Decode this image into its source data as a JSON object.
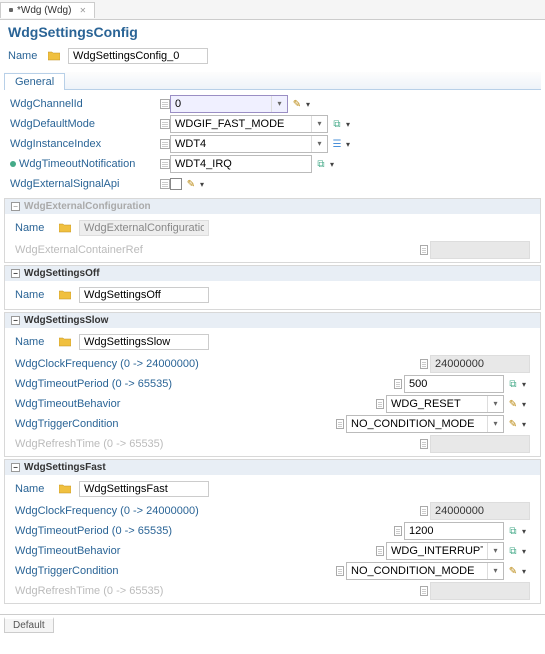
{
  "tab": {
    "title": "*Wdg (Wdg)"
  },
  "header": {
    "title": "WdgSettingsConfig",
    "name_label": "Name",
    "name_value": "WdgSettingsConfig_0"
  },
  "sub_tab": "General",
  "fields": {
    "channelId": {
      "label": "WdgChannelId",
      "value": "0"
    },
    "defaultMode": {
      "label": "WdgDefaultMode",
      "value": "WDGIF_FAST_MODE"
    },
    "instanceIndex": {
      "label": "WdgInstanceIndex",
      "value": "WDT4"
    },
    "timeoutNotif": {
      "label": "WdgTimeoutNotification",
      "value": "WDT4_IRQ"
    },
    "externalSignal": {
      "label": "WdgExternalSignalApi"
    }
  },
  "extConfig": {
    "header": "WdgExternalConfiguration",
    "name_label": "Name",
    "name_value": "WdgExternalConfiguration",
    "containerRef": "WdgExternalContainerRef"
  },
  "settingsOff": {
    "header": "WdgSettingsOff",
    "name_label": "Name",
    "name_value": "WdgSettingsOff"
  },
  "settingsSlow": {
    "header": "WdgSettingsSlow",
    "name_label": "Name",
    "name_value": "WdgSettingsSlow",
    "clockFreq": {
      "label": "WdgClockFrequency (0 -> 24000000)",
      "value": "24000000"
    },
    "timeoutPeriod": {
      "label": "WdgTimeoutPeriod (0 -> 65535)",
      "value": "500"
    },
    "timeoutBehavior": {
      "label": "WdgTimeoutBehavior",
      "value": "WDG_RESET"
    },
    "triggerCondition": {
      "label": "WdgTriggerCondition",
      "value": "NO_CONDITION_MODE"
    },
    "refreshTime": {
      "label": "WdgRefreshTime (0 -> 65535)"
    }
  },
  "settingsFast": {
    "header": "WdgSettingsFast",
    "name_label": "Name",
    "name_value": "WdgSettingsFast",
    "clockFreq": {
      "label": "WdgClockFrequency (0 -> 24000000)",
      "value": "24000000"
    },
    "timeoutPeriod": {
      "label": "WdgTimeoutPeriod (0 -> 65535)",
      "value": "1200"
    },
    "timeoutBehavior": {
      "label": "WdgTimeoutBehavior",
      "value": "WDG_INTERRUPT"
    },
    "triggerCondition": {
      "label": "WdgTriggerCondition",
      "value": "NO_CONDITION_MODE"
    },
    "refreshTime": {
      "label": "WdgRefreshTime (0 -> 65535)"
    }
  },
  "footer": {
    "tab": "Default"
  }
}
